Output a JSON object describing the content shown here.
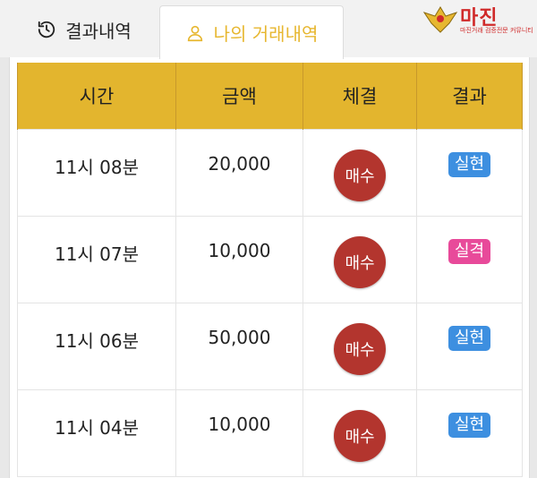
{
  "tabs": {
    "results_label": "결과내역",
    "mine_label": "나의 거래내역"
  },
  "logo": {
    "title": "마진",
    "subtitle": "마진거래 검증전문 커뮤니티"
  },
  "colors": {
    "header": "#e3b52e",
    "active_tab": "#e7b730",
    "buy": "#b3352e",
    "win": "#3d8fe0",
    "loss": "#e84a9a"
  },
  "table": {
    "headers": [
      "시간",
      "금액",
      "체결",
      "결과"
    ],
    "rows": [
      {
        "time": "11시 08분",
        "amount": "20,000",
        "trade": "매수",
        "result": "실현",
        "result_type": "win"
      },
      {
        "time": "11시 07분",
        "amount": "10,000",
        "trade": "매수",
        "result": "실격",
        "result_type": "loss"
      },
      {
        "time": "11시 06분",
        "amount": "50,000",
        "trade": "매수",
        "result": "실현",
        "result_type": "win"
      },
      {
        "time": "11시 04분",
        "amount": "10,000",
        "trade": "매수",
        "result": "실현",
        "result_type": "win"
      }
    ]
  }
}
